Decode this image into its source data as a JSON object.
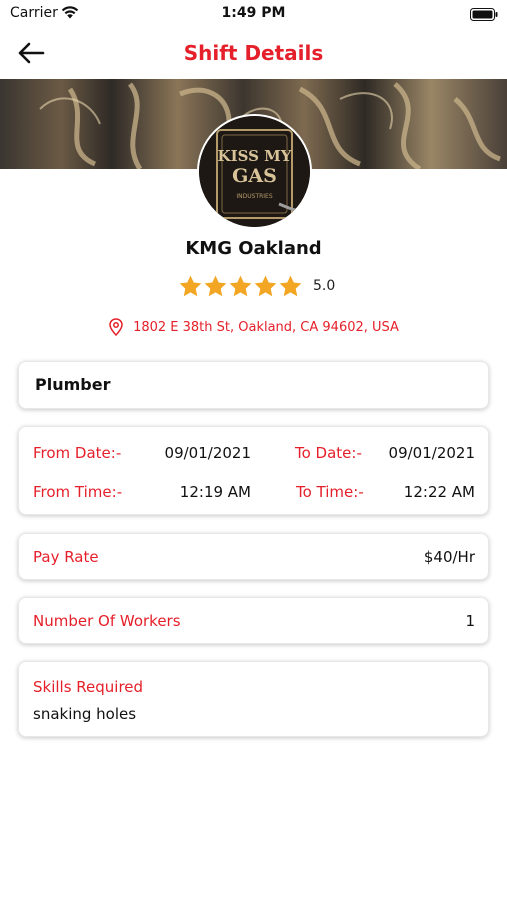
{
  "status_bar": {
    "carrier": "Carrier",
    "time": "1:49 PM",
    "wifi_icon": "wifi-icon",
    "battery_icon": "battery-icon"
  },
  "nav": {
    "back_icon": "back-arrow-icon",
    "title": "Shift Details"
  },
  "venue": {
    "name": "KMG Oakland",
    "rating_value": "5.0",
    "stars_filled": 5,
    "stars_total": 5,
    "address": "1802 E 38th St, Oakland, CA 94602, USA",
    "logo_text_line1": "KISS MY",
    "logo_text_line2": "GAS",
    "logo_text_line3": "INDUSTRIES"
  },
  "job": {
    "title": "Plumber"
  },
  "schedule": {
    "from_date_label": "From Date:-",
    "from_date": "09/01/2021",
    "to_date_label": "To Date:-",
    "to_date": "09/01/2021",
    "from_time_label": "From Time:-",
    "from_time": "12:19 AM",
    "to_time_label": "To Time:-",
    "to_time": "12:22 AM"
  },
  "pay": {
    "label": "Pay Rate",
    "value": "$40/Hr"
  },
  "workers": {
    "label": "Number Of Workers",
    "value": "1"
  },
  "skills": {
    "label": "Skills Required",
    "value": "snaking holes"
  },
  "colors": {
    "accent": "#e5202a",
    "star": "#f2a623",
    "text": "#111111",
    "background": "#ffffff"
  }
}
